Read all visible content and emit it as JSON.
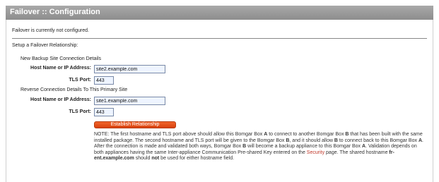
{
  "header": {
    "title": "Failover :: Configuration"
  },
  "status": {
    "message": "Failover is currently not configured."
  },
  "setup": {
    "section_title": "Setup a Failover Relationship:",
    "backup_group": {
      "title": "New Backup Site Connection Details",
      "host_label": "Host Name or IP Address:",
      "host_value": "site2.example.com",
      "port_label": "TLS Port:",
      "port_value": "443"
    },
    "reverse_group": {
      "title": "Reverse Connection Details To This Primary Site",
      "host_label": "Host Name or IP Address:",
      "host_value": "site1.example.com",
      "port_label": "TLS Port:",
      "port_value": "443"
    },
    "establish_button": "Establish Relationship"
  },
  "note": {
    "p1": "NOTE: The first hostname and TLS port above should allow this Bomgar Box ",
    "b1": "A",
    "p2": " to connect to another Bomgar Box ",
    "b2": "B",
    "p3": " that has been built with the same installed package. The second hostname and TLS port will be given to the Bomgar Box ",
    "b3": "B",
    "p4": ", and it should allow ",
    "b4": "B",
    "p5": " to connect back to this Bomgar Box ",
    "b5": "A",
    "p6": ". After the connection is made and validated both ways, Bomgar Box ",
    "b6": "B",
    "p7": " will become a backup appliance to this Bomgar Box ",
    "b7": "A",
    "p8": ". Validation depends on both appliances having the same Inter-appliance Communication Pre-shared Key entered on the ",
    "link": "Security",
    "p9": " page. The shared hostname ",
    "b8": "fr-ent.example.com",
    "p10": " should ",
    "b9": "not",
    "p11": " be used for either hostname field."
  }
}
